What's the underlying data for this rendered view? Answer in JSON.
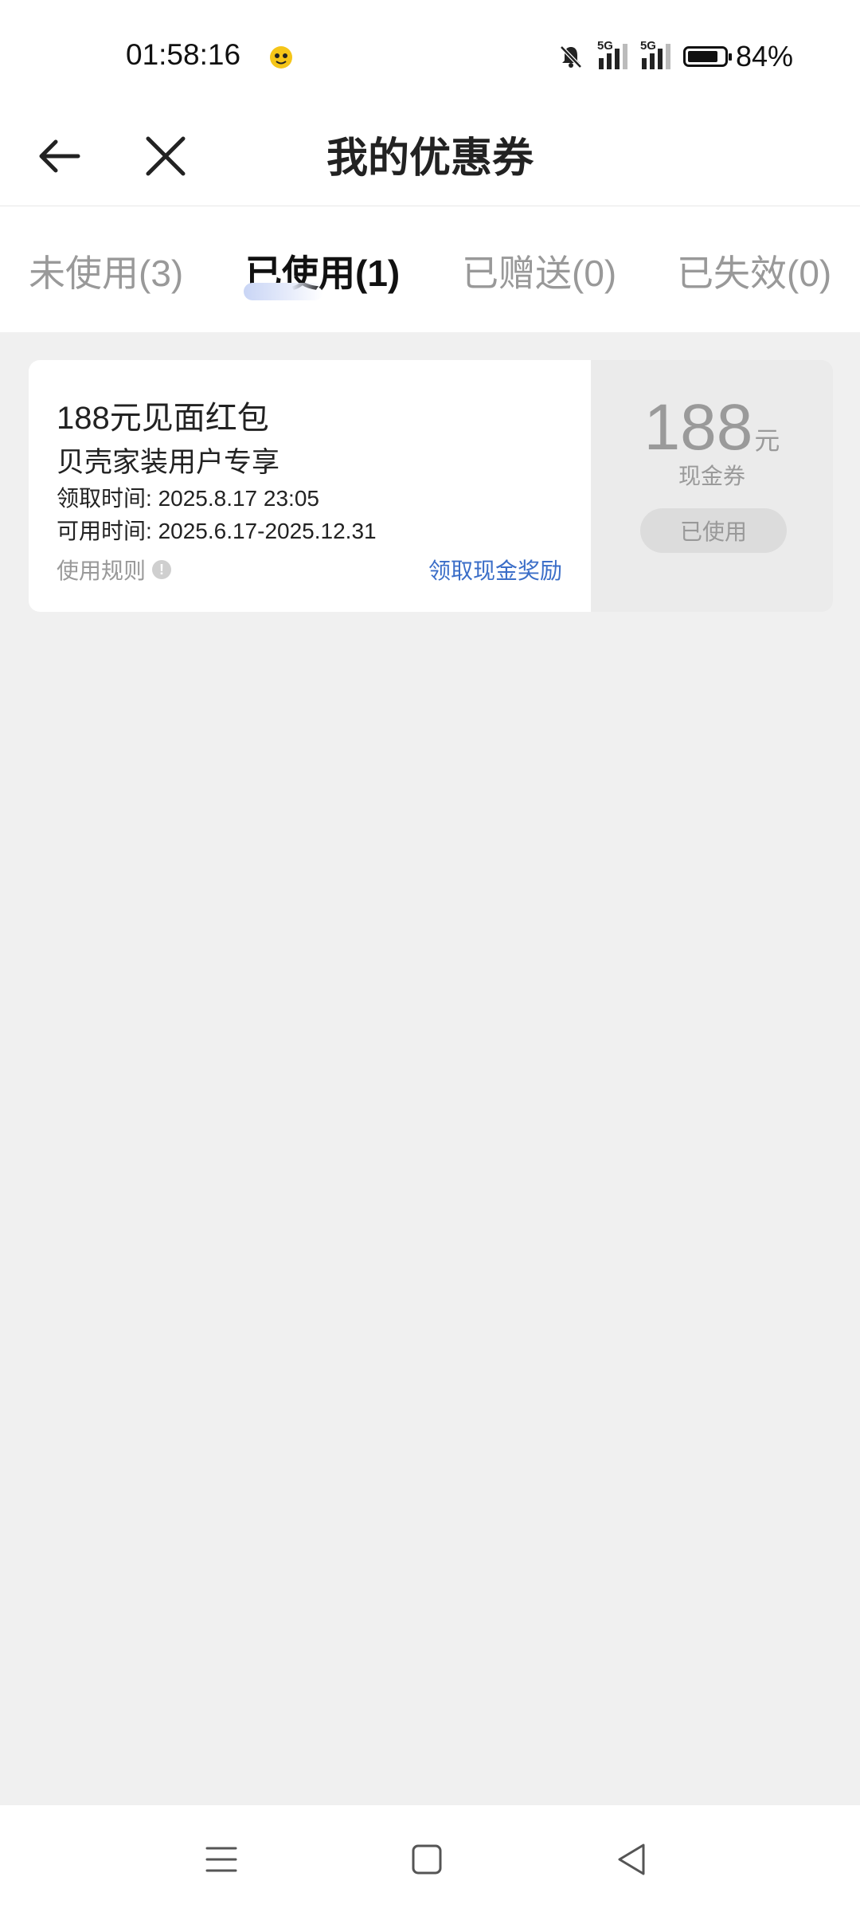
{
  "status_bar": {
    "time": "01:58:16",
    "signal1_label": "5G",
    "signal2_label": "5G",
    "battery_percent": "84%",
    "battery_level": 0.84,
    "icons": [
      "mute-bell-icon",
      "signal-icon",
      "battery-icon"
    ]
  },
  "nav": {
    "title": "我的优惠券"
  },
  "tabs": [
    {
      "label": "未使用(3)",
      "active": false
    },
    {
      "label": "已使用(1)",
      "active": true
    },
    {
      "label": "已赠送(0)",
      "active": false
    },
    {
      "label": "已失效(0)",
      "active": false
    }
  ],
  "coupon": {
    "title": "188元见面红包",
    "subtitle": "贝壳家装用户专享",
    "received_label": "领取时间:",
    "received_time": "2025.8.17 23:05",
    "valid_label": "可用时间:",
    "valid_time": "2025.6.17-2025.12.31",
    "rules_label": "使用规则",
    "link_label": "领取现金奖励",
    "amount": "188",
    "unit": "元",
    "type": "现金券",
    "status": "已使用"
  },
  "colors": {
    "accent_link": "#3b6ec8",
    "background": "#f0f0f0"
  }
}
